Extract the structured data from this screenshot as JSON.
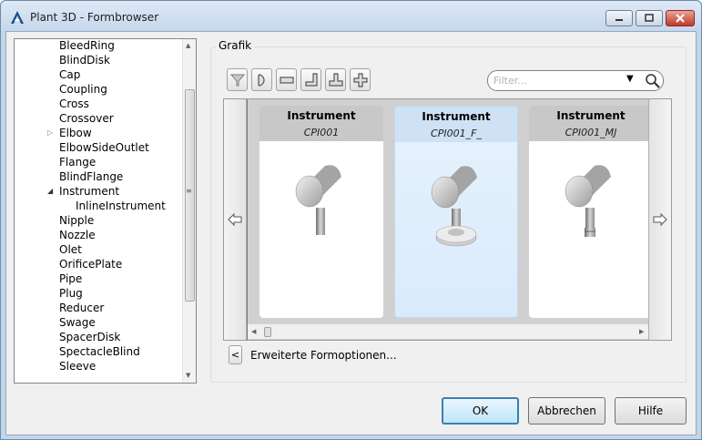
{
  "window": {
    "title": "Plant 3D - Formbrowser",
    "icon": "autocad-a-icon"
  },
  "tree": {
    "items": [
      {
        "label": "BleedRing",
        "level": 1
      },
      {
        "label": "BlindDisk",
        "level": 1
      },
      {
        "label": "Cap",
        "level": 1
      },
      {
        "label": "Coupling",
        "level": 1
      },
      {
        "label": "Cross",
        "level": 1
      },
      {
        "label": "Crossover",
        "level": 1
      },
      {
        "label": "Elbow",
        "level": 1,
        "expander": "collapsed"
      },
      {
        "label": "ElbowSideOutlet",
        "level": 1
      },
      {
        "label": "Flange",
        "level": 1
      },
      {
        "label": "BlindFlange",
        "level": 1
      },
      {
        "label": "Instrument",
        "level": 1,
        "expander": "expanded"
      },
      {
        "label": "InlineInstrument",
        "level": 2
      },
      {
        "label": "Nipple",
        "level": 1
      },
      {
        "label": "Nozzle",
        "level": 1
      },
      {
        "label": "Olet",
        "level": 1
      },
      {
        "label": "OrificePlate",
        "level": 1
      },
      {
        "label": "Pipe",
        "level": 1
      },
      {
        "label": "Plug",
        "level": 1
      },
      {
        "label": "Reducer",
        "level": 1
      },
      {
        "label": "Swage",
        "level": 1
      },
      {
        "label": "SpacerDisk",
        "level": 1
      },
      {
        "label": "SpectacleBlind",
        "level": 1
      },
      {
        "label": "Sleeve",
        "level": 1
      }
    ]
  },
  "graphics": {
    "group_label": "Grafik",
    "toolbar_icons": [
      "filter-icon",
      "half-round-end-icon",
      "straight-end-icon",
      "elbow-end-icon",
      "tee-end-icon",
      "cross-end-icon"
    ],
    "filter": {
      "placeholder": "Filter...",
      "value": ""
    },
    "cards": [
      {
        "title": "Instrument",
        "subtitle": "CPI001",
        "selected": false,
        "base": "plain"
      },
      {
        "title": "Instrument",
        "subtitle": "CPI001_F_",
        "selected": true,
        "base": "flange"
      },
      {
        "title": "Instrument",
        "subtitle": "CPI001_MJ",
        "selected": false,
        "base": "joint"
      }
    ]
  },
  "extended_options": {
    "button": "<",
    "label": "Erweiterte Formoptionen..."
  },
  "buttons": {
    "ok": "OK",
    "cancel": "Abbrechen",
    "help": "Hilfe"
  },
  "colors": {
    "selected_card": "#dbeaf9",
    "ok_border": "#3c7fb1"
  }
}
